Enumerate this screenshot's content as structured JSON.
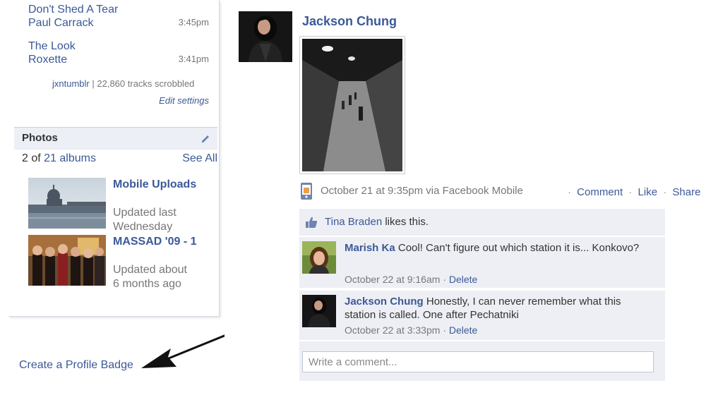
{
  "music": {
    "tracks": [
      {
        "title": "Don't Shed A Tear",
        "artist": "Paul Carrack",
        "time": "3:45pm"
      },
      {
        "title": "The Look",
        "artist": "Roxette",
        "time": "3:41pm"
      }
    ],
    "username": "jxntumblr",
    "scrobbled": "22,860 tracks scrobbled",
    "edit_settings": "Edit settings"
  },
  "photos": {
    "header": "Photos",
    "count_prefix": "2 of",
    "count_num": "21",
    "count_suffix": "albums",
    "see_all": "See All",
    "albums": [
      {
        "title": "Mobile Uploads",
        "subtitle_line1": "Updated last",
        "subtitle_line2": "Wednesday"
      },
      {
        "title": "MASSAD '09 - 1",
        "subtitle_line1": "Updated about",
        "subtitle_line2": "6 months ago"
      }
    ]
  },
  "create_badge": "Create a Profile Badge",
  "story": {
    "author": "Jackson Chung",
    "meta": "October 21 at 9:35pm via Facebook Mobile",
    "actions": {
      "comment": "Comment",
      "like": "Like",
      "share": "Share"
    },
    "likes": {
      "name": "Tina Braden",
      "text": "likes this."
    },
    "comments": [
      {
        "author": "Marish Ka",
        "text": "Cool! Can't figure out which station it is... Konkovo?",
        "time": "October 22 at 9:16am",
        "delete": "Delete"
      },
      {
        "author": "Jackson Chung",
        "text": "Honestly, I can never remember what this station is called. One after Pechatniki",
        "time": "October 22 at 3:33pm",
        "delete": "Delete"
      }
    ],
    "write_placeholder": "Write a comment..."
  },
  "colors": {
    "link": "#3b5998",
    "feedback_bg": "#edeff4",
    "header_bg": "#eceff5"
  }
}
